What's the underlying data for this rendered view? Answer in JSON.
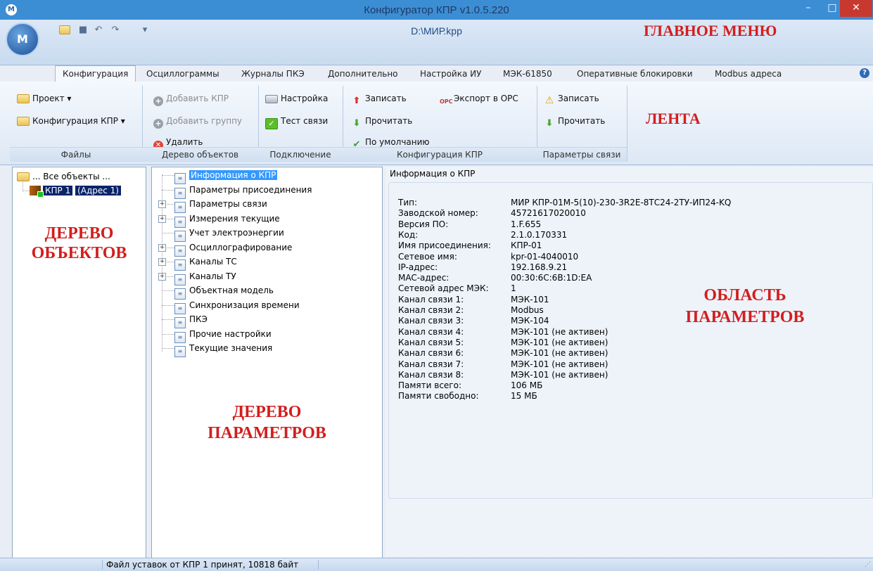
{
  "window": {
    "title": "Конфигуратор КПР v1.0.5.220",
    "file_path": "D:\\МИР.kpp",
    "controls": {
      "minimize": "–",
      "maximize": "□",
      "close": "✕"
    }
  },
  "annotations": {
    "main_menu": "ГЛАВНОЕ МЕНЮ",
    "ribbon": "ЛЕНТА",
    "object_tree_1": "ДЕРЕВО",
    "object_tree_2": "ОБЪЕКТОВ",
    "param_tree_1": "ДЕРЕВО",
    "param_tree_2": "ПАРАМЕТРОВ",
    "param_area_1": "ОБЛАСТЬ",
    "param_area_2": "ПАРАМЕТРОВ"
  },
  "tabs": [
    "Конфигурация",
    "Осциллограммы",
    "Журналы ПКЭ",
    "Дополнительно",
    "Настройка ИУ",
    "МЭК-61850",
    "Оперативные блокировки",
    "Modbus адреса"
  ],
  "ribbon": {
    "files": {
      "label": "Файлы",
      "project": "Проект",
      "config": "Конфигурация КПР"
    },
    "object_tree": {
      "label": "Дерево объектов",
      "add_kpr": "Добавить КПР",
      "add_group": "Добавить группу",
      "delete": "Удалить"
    },
    "connection": {
      "label": "Подключение",
      "settings": "Настройка",
      "test": "Тест связи"
    },
    "kpr_config": {
      "label": "Конфигурация КПР",
      "write": "Записать",
      "read": "Прочитать",
      "default": "По умолчанию",
      "export_opc": "Экспорт в OPC"
    },
    "link_params": {
      "label": "Параметры связи",
      "write": "Записать",
      "read": "Прочитать"
    }
  },
  "object_tree": {
    "root": "... Все объекты ...",
    "kpr_name": "КПР 1",
    "kpr_addr": "(Адрес 1)"
  },
  "param_tree": [
    {
      "label": "Информация о КПР",
      "expandable": false,
      "selected": true
    },
    {
      "label": "Параметры присоединения",
      "expandable": false
    },
    {
      "label": "Параметры связи",
      "expandable": true
    },
    {
      "label": "Измерения текущие",
      "expandable": true
    },
    {
      "label": "Учет электроэнергии",
      "expandable": false
    },
    {
      "label": "Осциллографирование",
      "expandable": true
    },
    {
      "label": "Каналы ТС",
      "expandable": true
    },
    {
      "label": "Каналы ТУ",
      "expandable": true
    },
    {
      "label": "Объектная модель",
      "expandable": false
    },
    {
      "label": "Синхронизация времени",
      "expandable": false
    },
    {
      "label": "ПКЭ",
      "expandable": false
    },
    {
      "label": "Прочие настройки",
      "expandable": false
    },
    {
      "label": "Текущие значения",
      "expandable": false
    }
  ],
  "info": {
    "heading": "Информация о КПР",
    "rows": [
      {
        "k": "Тип:",
        "v": "МИР КПР-01М-5(10)-230-3R2E-8ТС24-2ТУ-ИП24-KQ"
      },
      {
        "k": "Заводской номер:",
        "v": "45721617020010"
      },
      {
        "k": "Версия ПО:",
        "v": "1.F.655"
      },
      {
        "k": "Код:",
        "v": "2.1.0.170331"
      },
      {
        "k": "Имя присоединения:",
        "v": "КПР-01"
      },
      {
        "k": "Сетевое имя:",
        "v": "kpr-01-4040010"
      },
      {
        "k": "IP-адрес:",
        "v": "192.168.9.21"
      },
      {
        "k": "MAC-адрес:",
        "v": "00:30:6C:6B:1D:EA"
      },
      {
        "k": "Сетевой адрес МЭК:",
        "v": "1"
      },
      {
        "k": "Канал связи 1:",
        "v": "МЭК-101"
      },
      {
        "k": "Канал связи 2:",
        "v": "Modbus"
      },
      {
        "k": "Канал связи 3:",
        "v": "МЭК-104"
      },
      {
        "k": "Канал связи 4:",
        "v": "МЭК-101 (не активен)"
      },
      {
        "k": "Канал связи 5:",
        "v": "МЭК-101 (не активен)"
      },
      {
        "k": "Канал связи 6:",
        "v": "МЭК-101 (не активен)"
      },
      {
        "k": "Канал связи 7:",
        "v": "МЭК-101 (не активен)"
      },
      {
        "k": "Канал связи 8:",
        "v": "МЭК-101 (не активен)"
      },
      {
        "k": "Памяти всего:",
        "v": "106 МБ"
      },
      {
        "k": "Памяти свободно:",
        "v": "15 МБ"
      }
    ]
  },
  "status": {
    "text": "Файл уставок от КПР 1 принят, 10818 байт"
  }
}
